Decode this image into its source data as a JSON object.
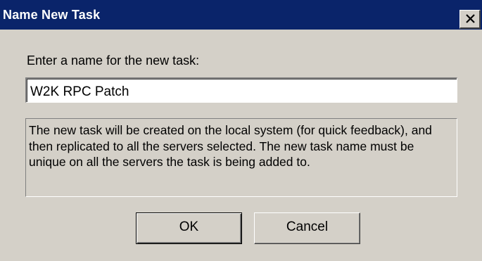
{
  "dialog": {
    "title": "Name New Task",
    "close_icon": "close-x-icon",
    "prompt": "Enter a name for the new task:",
    "task_name_value": "W2K RPC Patch",
    "info_text": "The new task will be created on the local system (for quick feedback), and then replicated to all the servers selected.  The new task name must be unique on all the servers the task is being added to.",
    "ok_label": "OK",
    "cancel_label": "Cancel"
  },
  "colors": {
    "titlebar": "#0a246a",
    "face": "#d4d0c8"
  }
}
